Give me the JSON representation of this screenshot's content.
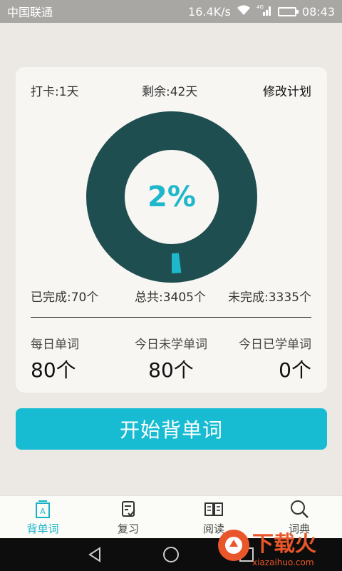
{
  "status_bar": {
    "carrier": "中国联通",
    "speed": "16.4K/s",
    "network": "4G",
    "time": "08:43"
  },
  "plan": {
    "checkin_label": "打卡:",
    "checkin_value": "1天",
    "remain_label": "剩余:",
    "remain_value": "42天",
    "edit_label": "修改计划"
  },
  "progress": {
    "percent_text": "2%",
    "fraction": 0.02,
    "ring_color": "#1f4e50",
    "accent_color": "#1fb7cc"
  },
  "stats": {
    "done_label": "已完成:",
    "done_value": "70个",
    "total_label": "总共:",
    "total_value": "3405个",
    "left_label": "未完成:",
    "left_value": "3335个"
  },
  "daily": [
    {
      "label": "每日单词",
      "value": "80个"
    },
    {
      "label": "今日未学单词",
      "value": "80个"
    },
    {
      "label": "今日已学单词",
      "value": "0个"
    }
  ],
  "start_button": "开始背单词",
  "tabs": [
    {
      "label": "背单词",
      "icon": "flashcard-icon",
      "active": true
    },
    {
      "label": "复习",
      "icon": "review-icon",
      "active": false
    },
    {
      "label": "阅读",
      "icon": "book-icon",
      "active": false
    },
    {
      "label": "词典",
      "icon": "search-icon",
      "active": false
    }
  ],
  "watermark": {
    "brand": "下载火",
    "url": "xiazaihuo.com"
  }
}
